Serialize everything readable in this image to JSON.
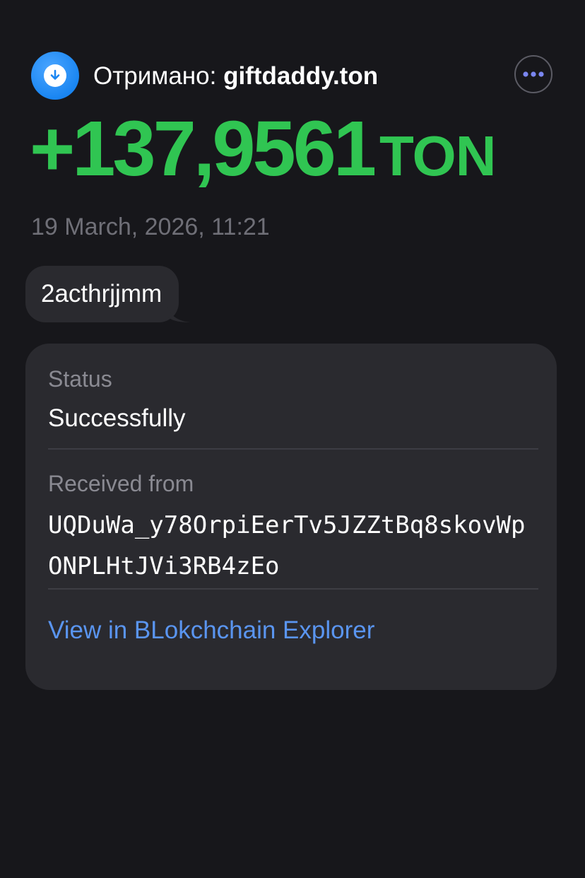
{
  "header": {
    "title_prefix": "Отримано:",
    "sender_name": "giftdaddy.ton",
    "icon": "download-arrow-icon",
    "more_icon": "more-dots-icon"
  },
  "transaction": {
    "amount": "+137,9561",
    "currency": "TON",
    "datetime": "19 March, 2026, 11:21",
    "comment": "2acthrjjmm"
  },
  "details": {
    "status_label": "Status",
    "status_value": "Successfully",
    "received_from_label": "Received from",
    "address": "UQDuWa_y78OrpiEerTv5JZZtBq8skovWpONPLHtJVi3RB4zEo",
    "explorer_link": "View in BLokchchain Explorer"
  },
  "colors": {
    "background": "#17171b",
    "amount_green": "#30c552",
    "accent_blue": "#1a86f2",
    "link_blue": "#5a95f0",
    "card": "#2a2a2f"
  }
}
